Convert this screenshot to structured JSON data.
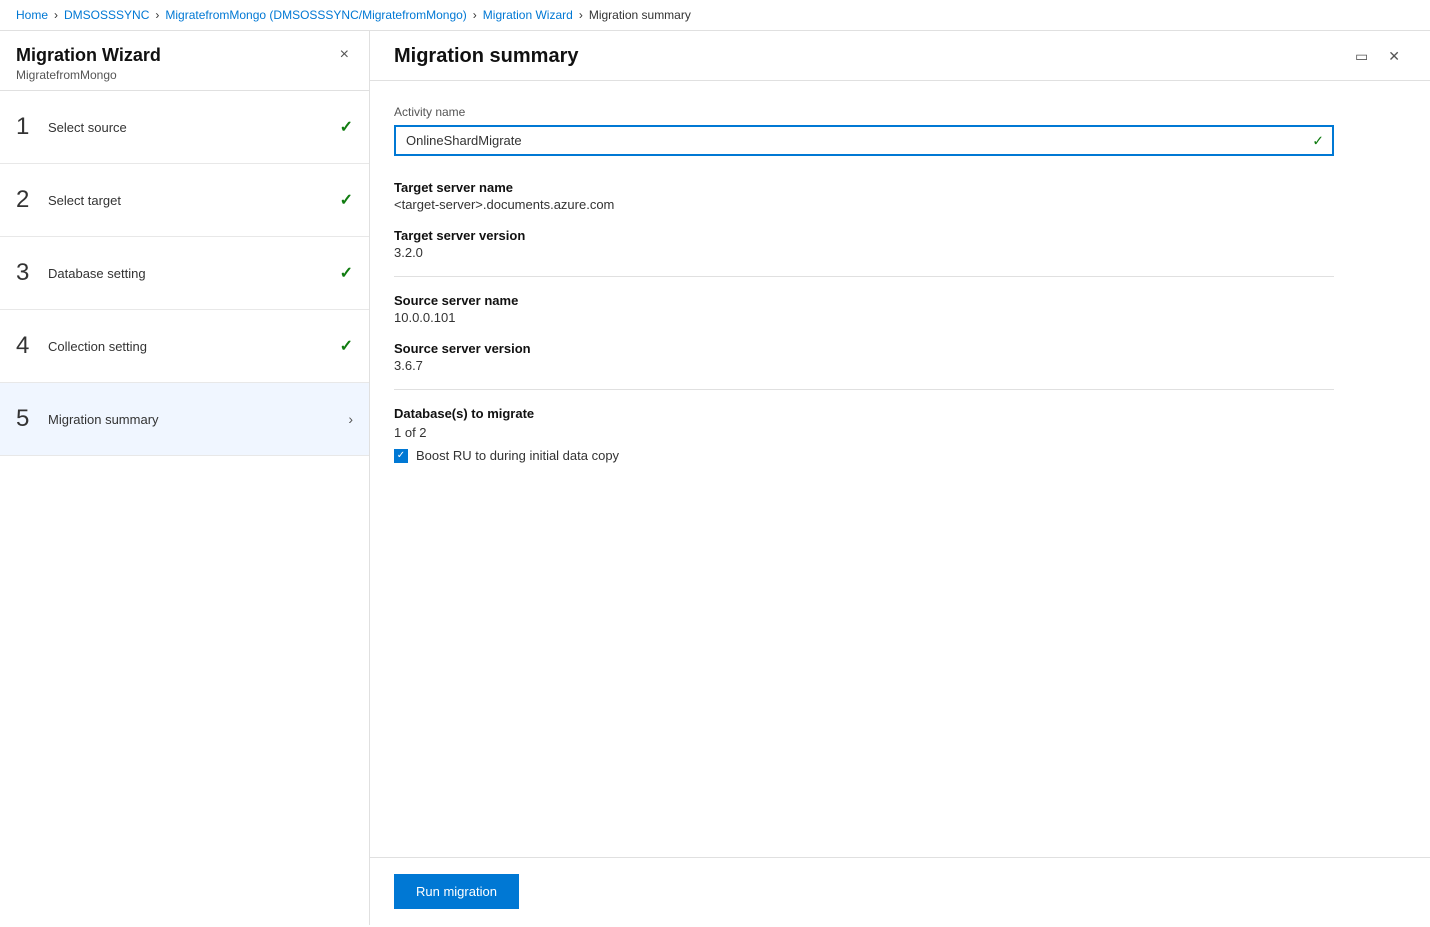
{
  "breadcrumb": {
    "items": [
      {
        "label": "Home",
        "href": true
      },
      {
        "label": "DMSOSSSYNC",
        "href": true
      },
      {
        "label": "MigratefromMongo (DMSOSSSYNC/MigratefromMongo)",
        "href": true
      },
      {
        "label": "Migration Wizard",
        "href": true
      },
      {
        "label": "Migration summary",
        "href": false
      }
    ]
  },
  "sidebar": {
    "title": "Migration Wizard",
    "subtitle": "MigratefromMongo",
    "close_label": "×",
    "steps": [
      {
        "number": "1",
        "label": "Select source",
        "status": "check",
        "active": false
      },
      {
        "number": "2",
        "label": "Select target",
        "status": "check",
        "active": false
      },
      {
        "number": "3",
        "label": "Database setting",
        "status": "check",
        "active": false
      },
      {
        "number": "4",
        "label": "Collection setting",
        "status": "check",
        "active": false
      },
      {
        "number": "5",
        "label": "Migration summary",
        "status": "arrow",
        "active": true
      }
    ]
  },
  "content": {
    "title": "Migration summary",
    "window_controls": {
      "minimize": "▭",
      "close": "✕"
    },
    "activity_name_label": "Activity name",
    "activity_name_value": "OnlineShardMigrate",
    "target_server_name_label": "Target server name",
    "target_server_name_value": "<target-server>.documents.azure.com",
    "target_server_version_label": "Target server version",
    "target_server_version_value": "3.2.0",
    "source_server_name_label": "Source server name",
    "source_server_name_value": "10.0.0.101",
    "source_server_version_label": "Source server version",
    "source_server_version_value": "3.6.7",
    "databases_label": "Database(s) to migrate",
    "databases_value": "1 of 2",
    "boost_ru_label": "Boost RU to during initial data copy",
    "run_migration_label": "Run migration"
  }
}
